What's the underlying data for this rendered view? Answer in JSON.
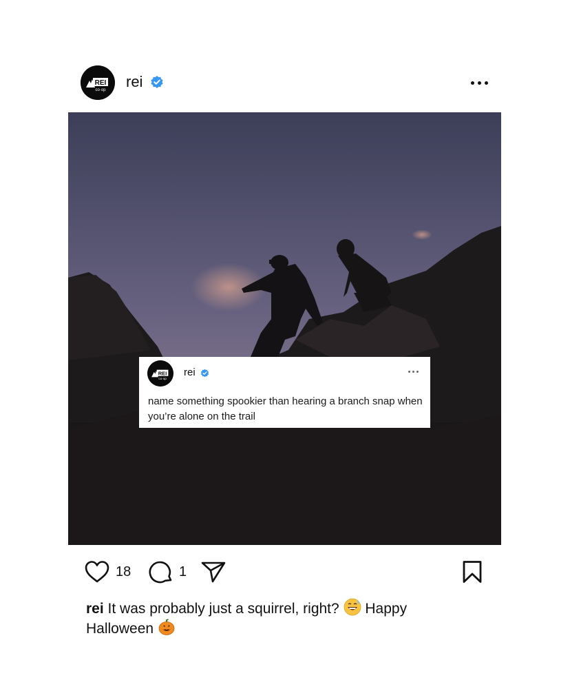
{
  "post": {
    "username": "rei",
    "avatar_logo": "REI co-op",
    "verified_icon": "verified-badge-icon",
    "more_icon": "more-horizontal-icon"
  },
  "tweet": {
    "username": "rei",
    "text": "name something spookier than hearing a branch snap when you’re alone on the trail"
  },
  "actions": {
    "like_icon": "heart-icon",
    "like_count": "18",
    "comment_icon": "comment-icon",
    "comment_count": "1",
    "share_icon": "send-icon",
    "save_icon": "bookmark-icon"
  },
  "caption": {
    "username": "rei",
    "text_part1": "It was probably just a squirrel, right?",
    "emoji1": "grinning-sweat-emoji",
    "text_part2": "Happy Halloween",
    "emoji2": "jack-o-lantern-emoji"
  },
  "colors": {
    "verified": "#3897f0",
    "sky_top": "#3e3f5a",
    "sky_bottom": "#8a7a90",
    "rock": "#1d1a1c"
  }
}
